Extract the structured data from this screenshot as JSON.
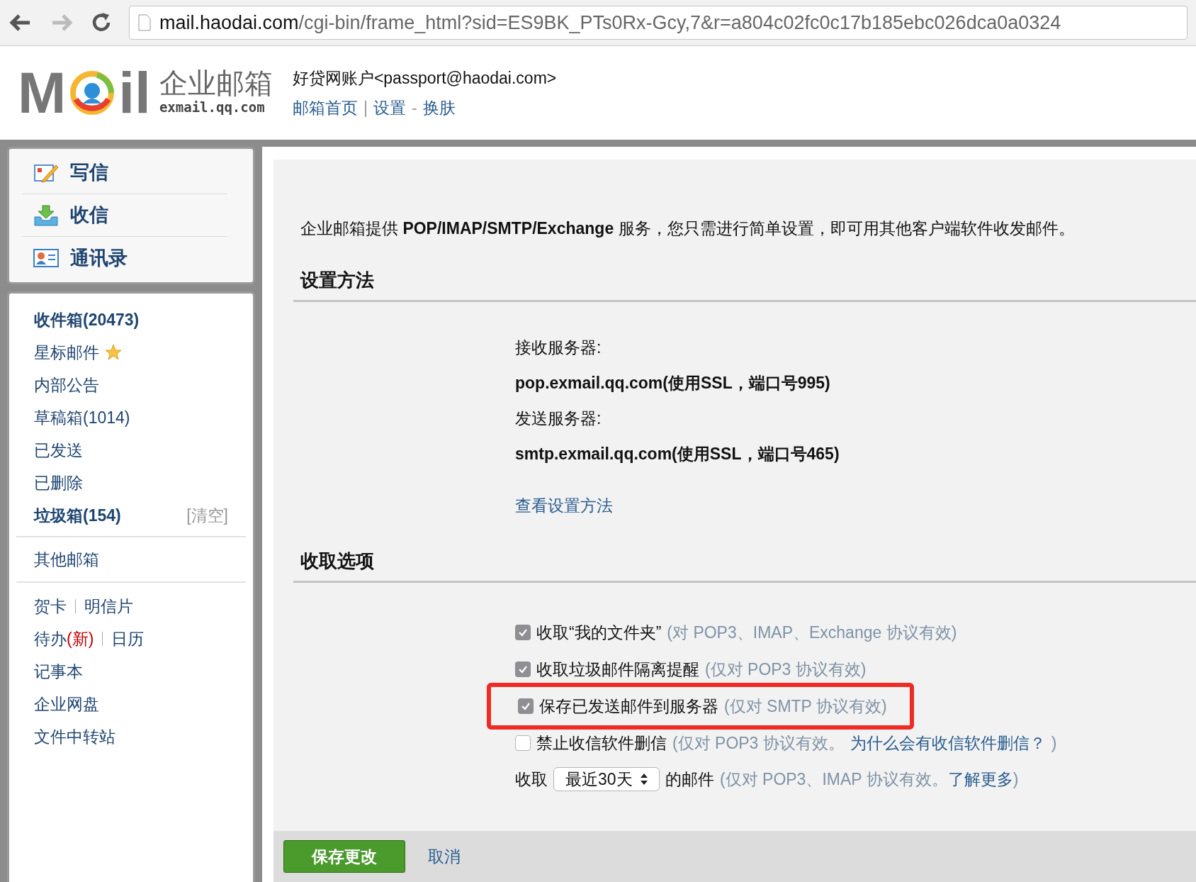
{
  "browser": {
    "url_host": "mail.haodai.com",
    "url_path": "/cgi-bin/frame_html?sid=ES9BK_PTs0Rx-Gcy,7&r=a804c02fc0c17b185ebc026dca0a0324"
  },
  "header": {
    "logo_left": "M",
    "logo_right": "il",
    "logo_title": "企业邮箱",
    "logo_domain": "exmail.qq.com",
    "account": "好贷网账户<passport@haodai.com>",
    "links": [
      {
        "label": "邮箱首页",
        "sep": "|"
      },
      {
        "label": "设置",
        "sep": "-"
      },
      {
        "label": "换肤"
      }
    ]
  },
  "sidebar": {
    "actions": [
      {
        "label": "写信",
        "kind": "write"
      },
      {
        "label": "收信",
        "kind": "receive"
      },
      {
        "label": "通讯录",
        "kind": "contacts"
      }
    ],
    "folders": [
      {
        "label": "收件箱(20473)",
        "bold": true
      },
      {
        "label": "星标邮件",
        "bold": false,
        "starred": true
      },
      {
        "label": "内部公告",
        "bold": false
      },
      {
        "label": "草稿箱(1014)",
        "bold": false
      },
      {
        "label": "已发送",
        "bold": false
      },
      {
        "label": "已删除",
        "bold": false
      },
      {
        "label": "垃圾箱(154)",
        "bold": true,
        "action": "[清空]"
      }
    ],
    "other": "其他邮箱",
    "tools": [
      [
        {
          "label": "贺卡"
        },
        {
          "label": "明信片"
        }
      ],
      [
        {
          "label": "待办",
          "badge": "(新)"
        },
        {
          "label": "日历"
        }
      ],
      [
        {
          "label": "记事本"
        }
      ],
      [
        {
          "label": "企业网盘"
        }
      ],
      [
        {
          "label": "文件中转站"
        }
      ]
    ]
  },
  "content": {
    "intro": "企业邮箱提供 **POP/IMAP/SMTP/Exchange** 服务，您只需进行简单设置，即可用其他客户端软件收发邮件。",
    "setup_heading": "设置方法",
    "servers": [
      {
        "label": "接收服务器:",
        "value": "pop.exmail.qq.com(使用SSL，端口号995)"
      },
      {
        "label": "发送服务器:",
        "value": "smtp.exmail.qq.com(使用SSL，端口号465)"
      }
    ],
    "setup_link": "查看设置方法",
    "options_heading": "收取选项",
    "options": [
      {
        "label": "收取“我的文件夹”",
        "hint": "(对 POP3、IMAP、Exchange 协议有效)",
        "checked": true,
        "highlighted": false
      },
      {
        "label": "收取垃圾邮件隔离提醒",
        "hint": "(仅对 POP3 协议有效)",
        "checked": true,
        "highlighted": false
      },
      {
        "label": "保存已发送邮件到服务器",
        "hint": "(仅对 SMTP 协议有效)",
        "checked": true,
        "highlighted": true
      },
      {
        "label": "禁止收信软件删信",
        "hint": "(仅对 POP3 协议有效。",
        "link": "为什么会有收信软件删信？",
        "hint_end": ")",
        "checked": false,
        "highlighted": false
      }
    ],
    "range": {
      "before": "收取",
      "select": "最近30天",
      "after": "的邮件",
      "hint": "(仅对 POP3、IMAP 协议有效。",
      "link": "了解更多",
      "hint_end": ")"
    }
  },
  "footer": {
    "save": "保存更改",
    "cancel": "取消"
  }
}
